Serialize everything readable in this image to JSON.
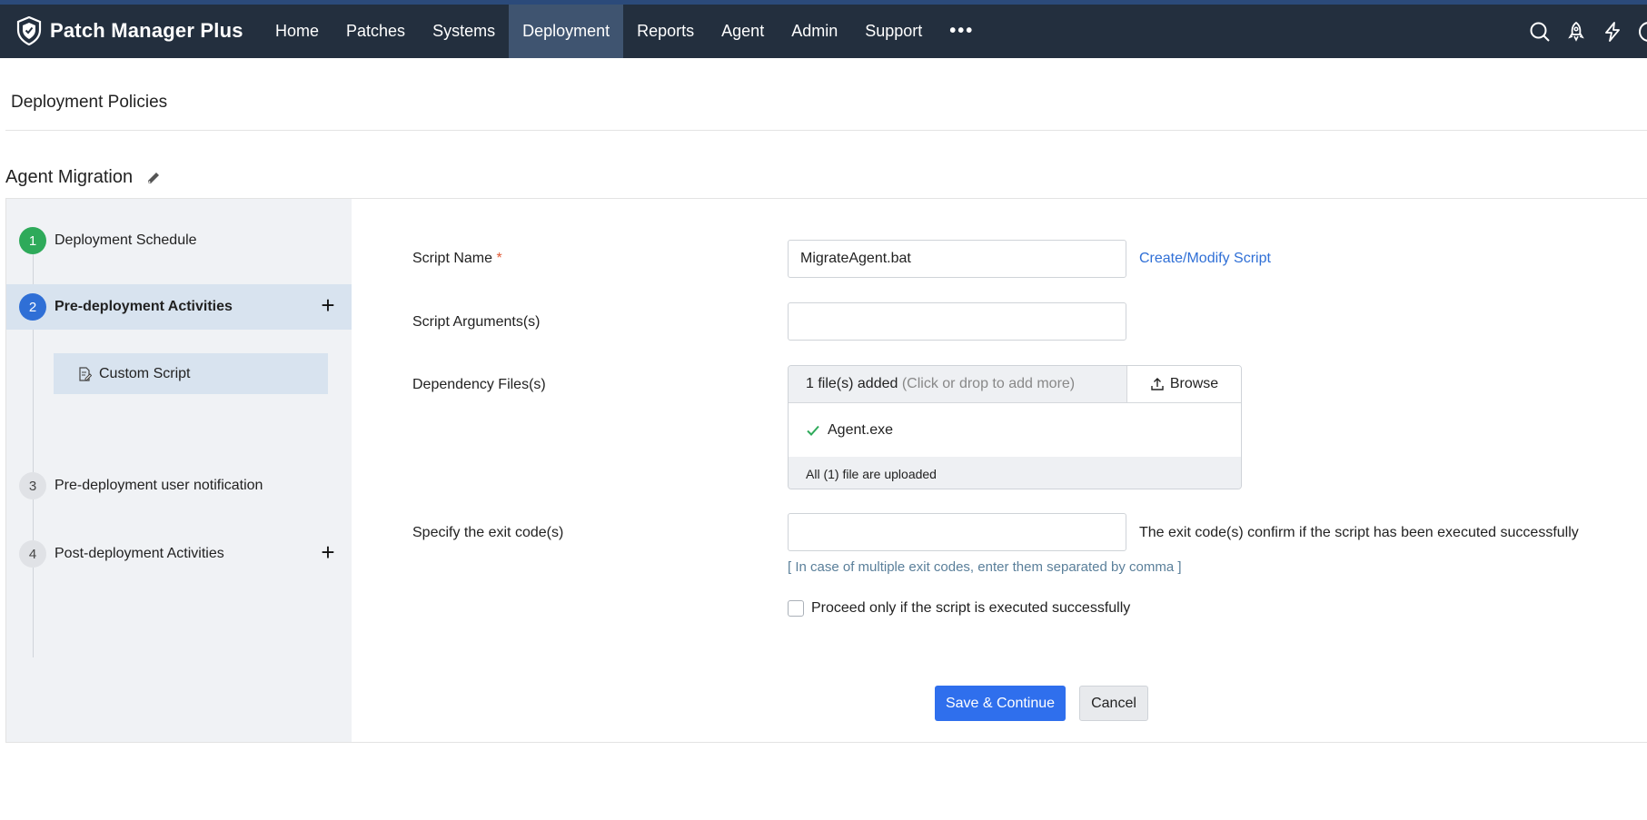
{
  "app": {
    "brand": "Patch Manager Plus"
  },
  "nav": {
    "items": [
      "Home",
      "Patches",
      "Systems",
      "Deployment",
      "Reports",
      "Agent",
      "Admin",
      "Support"
    ],
    "active": "Deployment",
    "more": "•••"
  },
  "top_icons": [
    "search-icon",
    "rocket-icon",
    "lightning-icon"
  ],
  "page": {
    "title": "Deployment Policies",
    "policy_name": "Agent Migration"
  },
  "steps": [
    {
      "num": "1",
      "label": "Deployment Schedule",
      "status": "completed"
    },
    {
      "num": "2",
      "label": "Pre-deployment Activities",
      "status": "active"
    },
    {
      "num": "3",
      "label": "Pre-deployment user notification",
      "status": "pending"
    },
    {
      "num": "4",
      "label": "Post-deployment Activities",
      "status": "pending"
    }
  ],
  "sub_item": {
    "label": "Custom Script"
  },
  "form": {
    "script_name_label": "Script Name",
    "required_mark": "*",
    "script_name_value": "MigrateAgent.bat",
    "create_modify_link": "Create/Modify Script",
    "script_args_label": "Script Arguments(s)",
    "script_args_value": "",
    "dependency_label": "Dependency Files(s)",
    "dependency_count": "1 file(s) added",
    "dependency_hint": "(Click or drop to add more)",
    "browse_label": "Browse",
    "uploaded_file": "Agent.exe",
    "upload_status": "All (1) file are uploaded",
    "exit_code_label": "Specify the exit code(s)",
    "exit_code_value": "",
    "exit_code_note": "The exit code(s) confirm if the script has been executed successfully",
    "exit_code_hint": "[ In case of multiple exit codes, enter them separated by comma ]",
    "proceed_label": "Proceed only if the script is executed successfully",
    "proceed_checked": false
  },
  "buttons": {
    "save": "Save & Continue",
    "cancel": "Cancel"
  },
  "colors": {
    "nav_bg": "#232f3e",
    "accent": "#2f6fed",
    "step_done": "#2eaa5a",
    "step_active": "#2f6fd6"
  }
}
